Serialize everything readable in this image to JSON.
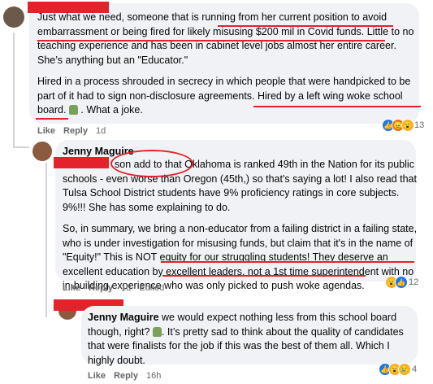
{
  "comment1": {
    "text_lines": [
      "Just what we need, someone that is running from her current position to avoid",
      "embarrassment or being fired for likely misusing $200 mil in Covid funds. Little to no",
      "teaching experience and has been in cabinet level jobs almost her entire career.",
      "She’s anything but an \"Educator.\""
    ],
    "para2_lines": [
      "Hired in a process shrouded in secrecy in which people that were handpicked to be",
      "part of it had to sign non-disclosure agreements. Hired by a left wing woke school"
    ],
    "last_line_a": "board.",
    "last_line_b": " . What a joke.",
    "like": "Like",
    "reply": "Reply",
    "time": "1d",
    "reaction_count": "13"
  },
  "comment2": {
    "author": "Jenny Maguire",
    "line1_tail": "son add to that Oklahoma is ranked 49th in the Nation for its public",
    "lines": [
      "schools - even worse than Oregon (45th,) so that's saying a lot! I also read that",
      "Tulsa School District students have 9% proficiency ratings in core subjects.",
      "9%!!! She has some explaining to do."
    ],
    "para2": [
      "So, in summary, we bring a non-educator from a failing district in a failing state,",
      "who is under investigation for misusing funds, but claim that it's in the name of",
      "\"Equity!\" This is NOT equity for our struggling students! They deserve an",
      "excellent education by excellent leaders, not a 1st time superintendent with no",
      "in-building experience who was only picked to push woke agendas."
    ],
    "like": "Like",
    "reply": "Reply",
    "time": "1d",
    "edited": "Edited",
    "reaction_count": "12"
  },
  "comment3": {
    "author": "Jenny Maguire",
    "line1_tail": " we would expect nothing less from this school board",
    "line2_a": "though, right? ",
    "line2_b": ". It’s pretty sad to think about the quality of candidates",
    "lines": [
      "that were finalists for the job if this was the best of them all. Which I",
      "highly doubt."
    ],
    "like": "Like",
    "reply": "Reply",
    "time": "16h",
    "reaction_count": "4"
  },
  "icons": {
    "like": "like-reaction-icon",
    "angry": "angry-reaction-icon",
    "wow": "wow-reaction-icon",
    "sad": "sad-reaction-icon",
    "emoji": "person-shrugging-emoji"
  },
  "colors": {
    "bubble": "#f0f2f5",
    "redaction": "#e4222b",
    "meta": "#65676b",
    "like_blue": "#1877f2"
  }
}
